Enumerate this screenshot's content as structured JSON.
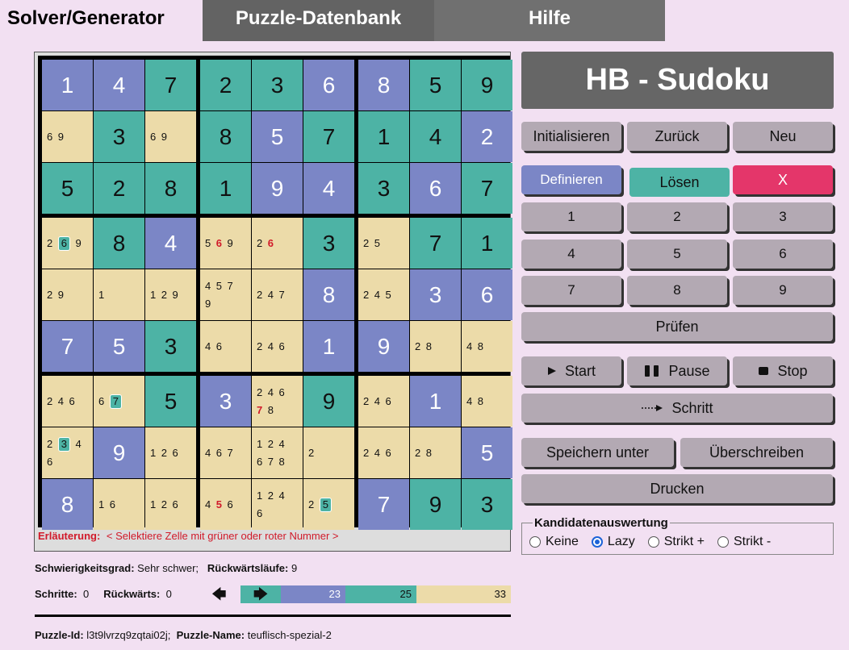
{
  "tabs": [
    "Solver/Generator",
    "Puzzle-Datenbank",
    "Hilfe"
  ],
  "board": {
    "rows": [
      [
        {
          "v": "1",
          "c": "purple"
        },
        {
          "v": "4",
          "c": "purple"
        },
        {
          "v": "7",
          "c": "teal"
        },
        {
          "v": "2",
          "c": "teal"
        },
        {
          "v": "3",
          "c": "teal"
        },
        {
          "v": "6",
          "c": "purple"
        },
        {
          "v": "8",
          "c": "purple"
        },
        {
          "v": "5",
          "c": "teal"
        },
        {
          "v": "9",
          "c": "teal"
        }
      ],
      [
        {
          "cand": [
            "6 9"
          ]
        },
        {
          "v": "3",
          "c": "teal"
        },
        {
          "cand": [
            "6 9"
          ]
        },
        {
          "v": "8",
          "c": "teal"
        },
        {
          "v": "5",
          "c": "purple"
        },
        {
          "v": "7",
          "c": "teal"
        },
        {
          "v": "1",
          "c": "teal"
        },
        {
          "v": "4",
          "c": "teal"
        },
        {
          "v": "2",
          "c": "purple"
        }
      ],
      [
        {
          "v": "5",
          "c": "teal"
        },
        {
          "v": "2",
          "c": "teal"
        },
        {
          "v": "8",
          "c": "teal"
        },
        {
          "v": "1",
          "c": "teal"
        },
        {
          "v": "9",
          "c": "purple"
        },
        {
          "v": "4",
          "c": "purple"
        },
        {
          "v": "3",
          "c": "teal"
        },
        {
          "v": "6",
          "c": "purple"
        },
        {
          "v": "7",
          "c": "teal"
        }
      ],
      [
        {
          "cand": [
            "2 ",
            "[6]",
            " 9"
          ]
        },
        {
          "v": "8",
          "c": "teal"
        },
        {
          "v": "4",
          "c": "purple"
        },
        {
          "cand": [
            "5 ",
            "{6}",
            " 9"
          ]
        },
        {
          "cand": [
            "2 ",
            "{6}"
          ]
        },
        {
          "v": "3",
          "c": "teal"
        },
        {
          "cand": [
            "2 5"
          ]
        },
        {
          "v": "7",
          "c": "teal"
        },
        {
          "v": "1",
          "c": "teal"
        }
      ],
      [
        {
          "cand": [
            "2 9"
          ]
        },
        {
          "cand": [
            "1"
          ]
        },
        {
          "cand": [
            "1 2 9"
          ]
        },
        {
          "cand": [
            "4 5 7\n9"
          ]
        },
        {
          "cand": [
            "2 4 7"
          ]
        },
        {
          "v": "8",
          "c": "purple"
        },
        {
          "cand": [
            "2 4 5"
          ]
        },
        {
          "v": "3",
          "c": "purple"
        },
        {
          "v": "6",
          "c": "purple"
        }
      ],
      [
        {
          "v": "7",
          "c": "purple"
        },
        {
          "v": "5",
          "c": "purple"
        },
        {
          "v": "3",
          "c": "teal"
        },
        {
          "cand": [
            "4 6"
          ]
        },
        {
          "cand": [
            "2 4 6"
          ]
        },
        {
          "v": "1",
          "c": "purple"
        },
        {
          "v": "9",
          "c": "purple"
        },
        {
          "cand": [
            "2 8"
          ]
        },
        {
          "cand": [
            "4 8"
          ]
        }
      ],
      [
        {
          "cand": [
            "2 4 6"
          ]
        },
        {
          "cand": [
            "6 ",
            "[7]"
          ]
        },
        {
          "v": "5",
          "c": "teal"
        },
        {
          "v": "3",
          "c": "purple"
        },
        {
          "cand": [
            "2 4 6\n",
            "{7}",
            " 8"
          ]
        },
        {
          "v": "9",
          "c": "teal"
        },
        {
          "cand": [
            "2 4 6"
          ]
        },
        {
          "v": "1",
          "c": "purple"
        },
        {
          "cand": [
            "4 8"
          ]
        }
      ],
      [
        {
          "cand": [
            "2 ",
            "[3]",
            " 4\n6"
          ]
        },
        {
          "v": "9",
          "c": "purple"
        },
        {
          "cand": [
            "1 2 6"
          ]
        },
        {
          "cand": [
            "4 6 7"
          ]
        },
        {
          "cand": [
            "1 2 4\n6 7 8"
          ]
        },
        {
          "cand": [
            "2"
          ]
        },
        {
          "cand": [
            "2 4 6"
          ]
        },
        {
          "cand": [
            "2 8"
          ]
        },
        {
          "v": "5",
          "c": "purple"
        }
      ],
      [
        {
          "v": "8",
          "c": "purple"
        },
        {
          "cand": [
            "1 6"
          ]
        },
        {
          "cand": [
            "1 2 6"
          ]
        },
        {
          "cand": [
            "4 ",
            "{5}",
            " 6"
          ]
        },
        {
          "cand": [
            "1 2 4\n6"
          ]
        },
        {
          "cand": [
            "2 ",
            "[5]"
          ]
        },
        {
          "v": "7",
          "c": "purple"
        },
        {
          "v": "9",
          "c": "teal"
        },
        {
          "v": "3",
          "c": "teal"
        }
      ]
    ],
    "erlaeuterung_label": "Erläuterung:",
    "erlaeuterung_text": "< Selektiere Zelle mit grüner oder roter Nummer >"
  },
  "info": {
    "schwierigkeit_label": "Schwierigkeitsgrad:",
    "schwierigkeit_value": "Sehr schwer;",
    "rueckwaertslaeufe_label": "Rückwärtsläufe:",
    "rueckwaertslaeufe_value": "9",
    "schritte_label": "Schritte:",
    "schritte_value": "0",
    "rueckwaerts_label": "Rückwärts:",
    "rueckwaerts_value": "0",
    "puzzle_id_label": "Puzzle-Id:",
    "puzzle_id_value": "l3t9lvrzq9zqtai02j;",
    "puzzle_name_label": "Puzzle-Name:",
    "puzzle_name_value": "teuflisch-spezial-2"
  },
  "progress": [
    {
      "value": "23",
      "color": "#7b86c6",
      "fraction": 0.238
    },
    {
      "value": "25",
      "color": "#4db3a5",
      "fraction": 0.26
    },
    {
      "value": "33",
      "color": "#ecdba9",
      "fraction": 0.345
    }
  ],
  "panel": {
    "title": "HB - Sudoku",
    "initialisieren": "Initialisieren",
    "zurueck": "Zurück",
    "neu": "Neu",
    "definieren": "Definieren",
    "loesen": "Lösen",
    "x": "X",
    "digits": [
      "1",
      "2",
      "3",
      "4",
      "5",
      "6",
      "7",
      "8",
      "9"
    ],
    "pruefen": "Prüfen",
    "start": "Start",
    "pause": "Pause",
    "stop": "Stop",
    "schritt": "Schritt",
    "speichern_unter": "Speichern unter",
    "ueberschreiben": "Überschreiben",
    "drucken": "Drucken",
    "kandidaten_legend": "Kandidatenauswertung",
    "radio_options": [
      "Keine",
      "Lazy",
      "Strikt +",
      "Strikt -"
    ],
    "radio_selected": "Lazy"
  },
  "colors": {
    "purple": "#7b86c6",
    "teal": "#4db3a5",
    "cream": "#ecdba9",
    "red": "#e4366a"
  }
}
